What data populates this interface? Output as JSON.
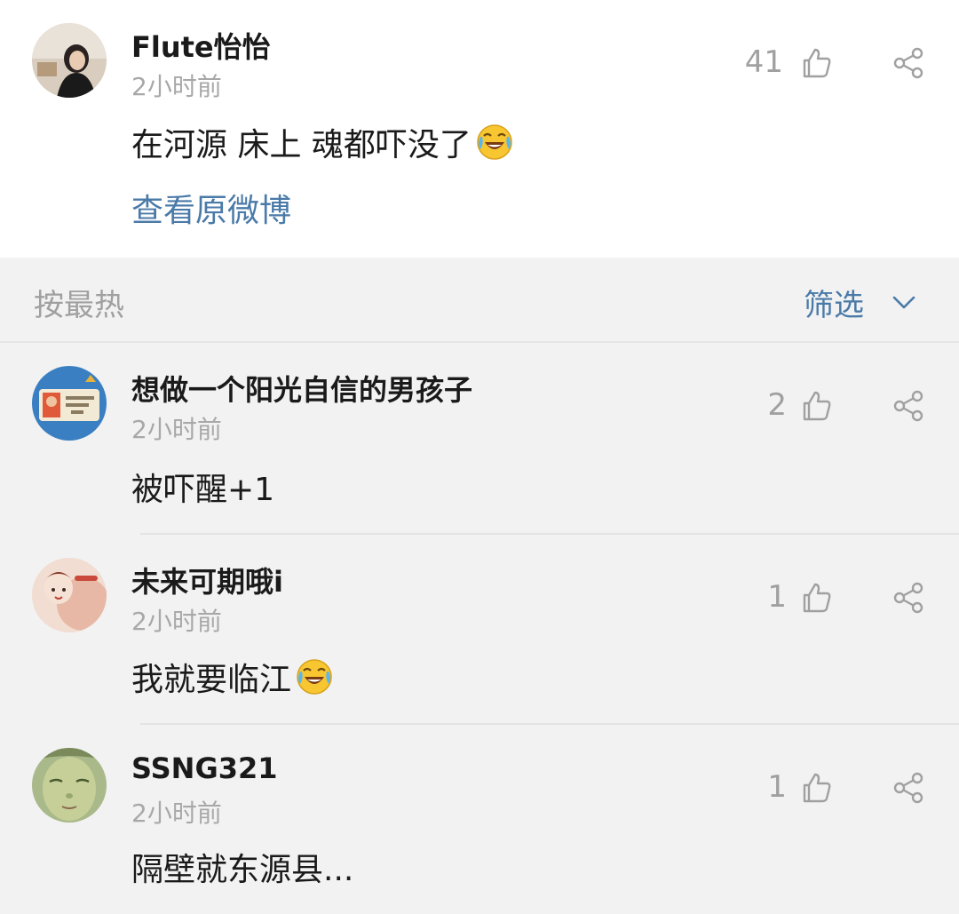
{
  "post": {
    "username": "Flute怡怡",
    "time": "2小时前",
    "content": "在河源 床上 魂都吓没了",
    "emoji": "laugh-cry-emoji",
    "likes": "41",
    "view_original": "查看原微博"
  },
  "sort_bar": {
    "sort_label": "按最热",
    "filter_label": "筛选"
  },
  "comments": [
    {
      "username": "想做一个阳光自信的男孩子",
      "time": "2小时前",
      "content": "被吓醒+1",
      "likes": "2"
    },
    {
      "username": "未来可期哦i",
      "time": "2小时前",
      "content": "我就要临江",
      "emoji": "laugh-cry-emoji",
      "likes": "1"
    },
    {
      "username": "SSNG321",
      "time": "2小时前",
      "content": "隔壁就东源县...",
      "likes": "1"
    }
  ],
  "colors": {
    "link_blue": "#4a7aa8",
    "muted_gray": "#a0a0a0",
    "text_dark": "#1a1a1a",
    "background": "#f2f2f2"
  }
}
